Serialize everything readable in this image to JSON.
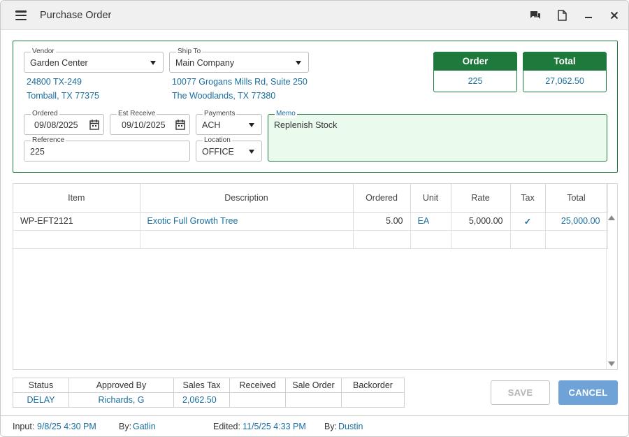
{
  "window": {
    "title": "Purchase Order"
  },
  "vendor": {
    "label": "Vendor",
    "value": "Garden Center",
    "addr1": "24800 TX-249",
    "addr2": "Tomball, TX 77375"
  },
  "shipto": {
    "label": "Ship To",
    "value": "Main Company",
    "addr1": "10077 Grogans Mills Rd, Suite 250",
    "addr2": "The Woodlands, TX 77380"
  },
  "order": {
    "label": "Order",
    "value": "225"
  },
  "total": {
    "label": "Total",
    "value": "27,062.50"
  },
  "ordered": {
    "label": "Ordered",
    "value": "09/08/2025"
  },
  "est_receive": {
    "label": "Est Receive",
    "value": "09/10/2025"
  },
  "payments": {
    "label": "Payments",
    "value": "ACH"
  },
  "reference": {
    "label": "Reference",
    "value": "225"
  },
  "location": {
    "label": "Location",
    "value": "OFFICE"
  },
  "memo": {
    "label": "Memo",
    "value": "Replenish Stock"
  },
  "grid": {
    "headers": {
      "item": "Item",
      "description": "Description",
      "ordered": "Ordered",
      "unit": "Unit",
      "rate": "Rate",
      "tax": "Tax",
      "total": "Total"
    },
    "rows": [
      {
        "item": "WP-EFT2121",
        "description": "Exotic Full Growth Tree",
        "ordered": "5.00",
        "unit": "EA",
        "rate": "5,000.00",
        "tax": "✓",
        "total": "25,000.00"
      }
    ]
  },
  "summary": {
    "headers": {
      "status": "Status",
      "approved_by": "Approved By",
      "sales_tax": "Sales Tax",
      "received": "Received",
      "sale_order": "Sale Order",
      "backorder": "Backorder"
    },
    "values": {
      "status": "DELAY",
      "approved_by": "Richards, G",
      "sales_tax": "2,062.50",
      "received": "",
      "sale_order": "",
      "backorder": ""
    }
  },
  "buttons": {
    "save": "SAVE",
    "cancel": "CANCEL"
  },
  "footer": {
    "input_label": "Input:",
    "input_value": "9/8/25 4:30 PM",
    "by1_label": "By:",
    "by1_value": "Gatlin",
    "edited_label": "Edited:",
    "edited_value": "11/5/25 4:33 PM",
    "by2_label": "By:",
    "by2_value": "Dustin"
  },
  "colors": {
    "accent_green": "#1e7a3c",
    "link_blue": "#1a6e9e",
    "cancel_blue": "#6fa3d8"
  }
}
